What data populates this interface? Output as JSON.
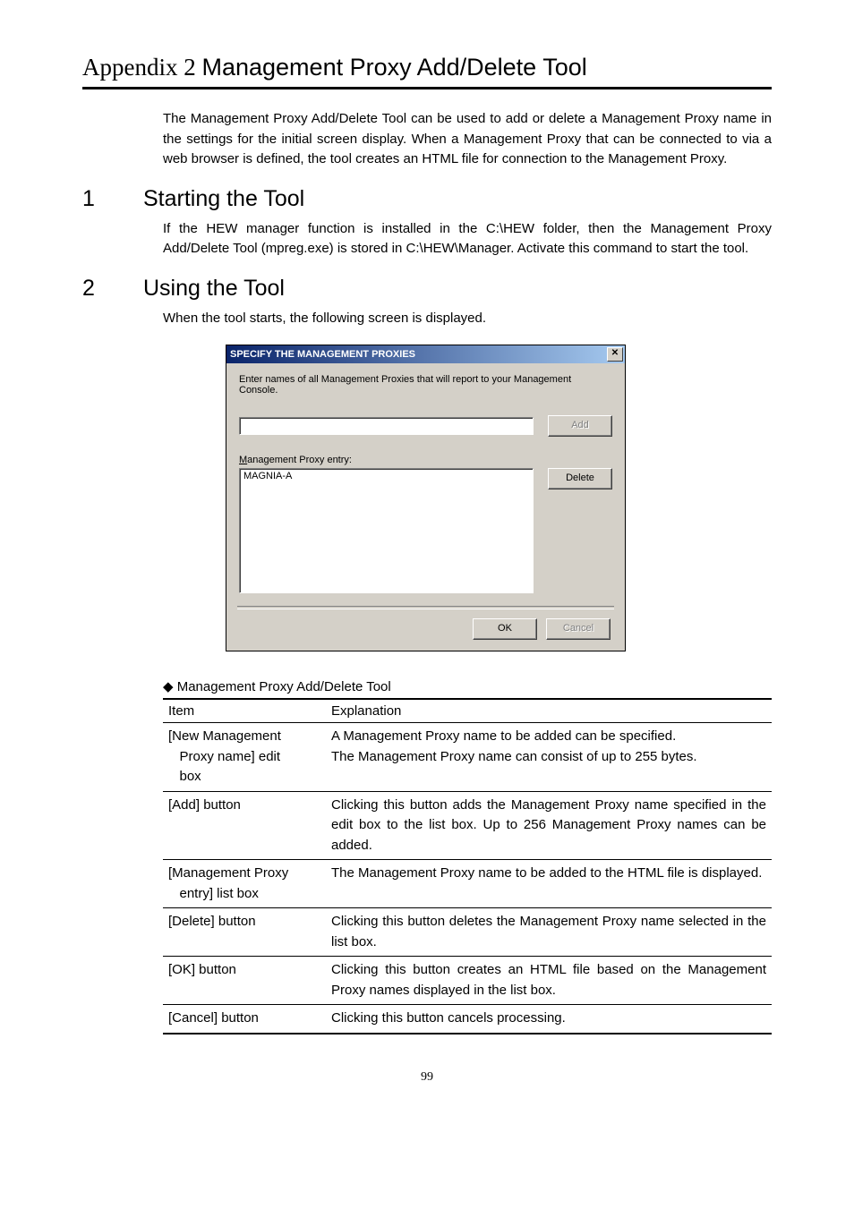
{
  "appendix": {
    "prefix": "Appendix 2",
    "title": "Management Proxy Add/Delete Tool",
    "intro": "The Management Proxy Add/Delete Tool can be used to add or delete a Management Proxy name in the settings for the initial screen display. When a Management Proxy that can be connected to via a web browser is defined, the tool creates an HTML file for connection to the Management Proxy."
  },
  "sections": [
    {
      "num": "1",
      "title": "Starting the Tool",
      "body": "If the HEW manager function is installed in the C:\\HEW folder, then the Management Proxy Add/Delete Tool (mpreg.exe) is stored in C:\\HEW\\Manager. Activate this command to start the tool."
    },
    {
      "num": "2",
      "title": "Using the Tool",
      "body": "When the tool starts, the following screen is displayed."
    }
  ],
  "dialog": {
    "title": "SPECIFY THE MANAGEMENT PROXIES",
    "close": "✕",
    "instruction": "Enter names of all Management Proxies that will report to your Management Console.",
    "add_btn": "Add",
    "entry_label_pre": "M",
    "entry_label_rest": "anagement Proxy entry:",
    "list_item": "MAGNIA-A",
    "delete_btn": "Delete",
    "ok_btn": "OK",
    "cancel_btn": "Cancel"
  },
  "table": {
    "caption": "◆ Management Proxy Add/Delete Tool",
    "header": {
      "item": "Item",
      "explanation": "Explanation"
    },
    "rows": [
      {
        "item": "[New Management Proxy name] edit box",
        "exp": "A Management Proxy name to be added can be specified.\nThe Management Proxy name can consist of up to 255 bytes."
      },
      {
        "item": "[Add] button",
        "exp": "Clicking this button adds the Management Proxy name specified in the edit box to the list box. Up to 256 Management Proxy names can be added."
      },
      {
        "item": "[Management Proxy entry] list box",
        "exp": "The Management Proxy name to be added to the HTML file is displayed."
      },
      {
        "item": "[Delete] button",
        "exp": "Clicking this button deletes the Management Proxy name selected in the list box."
      },
      {
        "item": "[OK] button",
        "exp": "Clicking this button creates an HTML file based on the Management Proxy names displayed in the list box."
      },
      {
        "item": "[Cancel] button",
        "exp": "Clicking this button cancels processing."
      }
    ]
  },
  "page_number": "99"
}
